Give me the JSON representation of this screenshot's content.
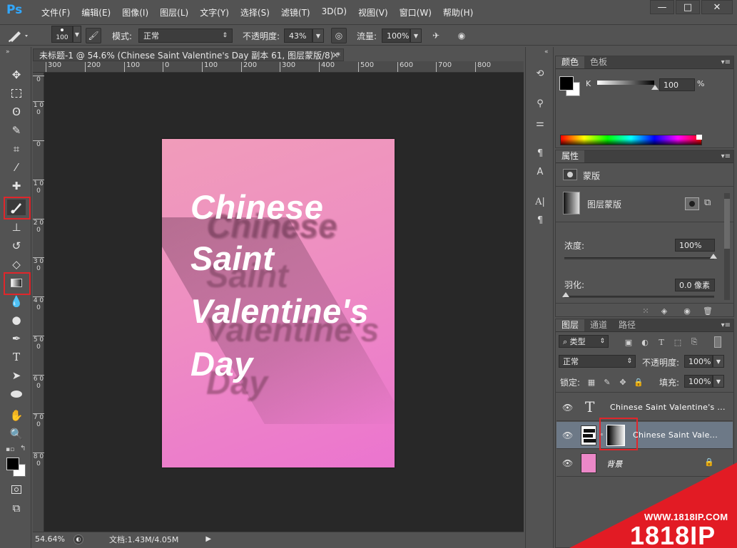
{
  "app": {
    "logo": "Ps"
  },
  "menu": [
    "文件(F)",
    "编辑(E)",
    "图像(I)",
    "图层(L)",
    "文字(Y)",
    "选择(S)",
    "滤镜(T)",
    "3D(D)",
    "视图(V)",
    "窗口(W)",
    "帮助(H)"
  ],
  "window_controls": {
    "minimize": "—",
    "restore": "□",
    "close": "✕"
  },
  "options": {
    "brush_size": "100",
    "mode_label": "模式:",
    "mode_value": "正常",
    "opacity_label": "不透明度:",
    "opacity_value": "43%",
    "flow_label": "流量:",
    "flow_value": "100%"
  },
  "document": {
    "tab_title": "未标题-1 @ 54.6% (Chinese  Saint  Valentine's  Day 副本 61, 图层蒙版/8) *",
    "tab_close": "×",
    "ruler_h": [
      "300",
      "200",
      "100",
      "0",
      "100",
      "200",
      "300",
      "400",
      "500",
      "600",
      "700",
      "800"
    ],
    "ruler_v": [
      "0",
      "1 0 0",
      "0",
      "1 0 0",
      "2 0 0",
      "3 0 0",
      "4 0 0",
      "5 0 0",
      "6 0 0",
      "7 0 0",
      "8 0 0"
    ],
    "canvas_lines": [
      "Chinese",
      "Saint",
      "Valentine's",
      "Day"
    ],
    "gradient_colors": [
      "#f09cba",
      "#eb74cf"
    ]
  },
  "status": {
    "zoom": "54.64%",
    "doc_info": "文档:1.43M/4.05M"
  },
  "color_panel": {
    "tabs": [
      "颜色",
      "色板"
    ],
    "channel": "K",
    "value": "100",
    "unit": "%"
  },
  "properties_panel": {
    "tab": "属性",
    "section_title": "蒙版",
    "mask_label": "图层蒙版",
    "density_label": "浓度:",
    "density_value": "100%",
    "feather_label": "羽化:",
    "feather_value": "0.0 像素"
  },
  "layers_panel": {
    "tabs": [
      "图层",
      "通道",
      "路径"
    ],
    "filter_label": "类型",
    "blend_mode": "正常",
    "opacity_label": "不透明度:",
    "opacity_value": "100%",
    "lock_label": "锁定:",
    "fill_label": "填充:",
    "fill_value": "100%",
    "layers": [
      {
        "name": "Chinese  Saint  Valentine's ...",
        "type": "text"
      },
      {
        "name": "Chinese  Saint  Vale...",
        "type": "masked"
      },
      {
        "name": "背景",
        "type": "background"
      }
    ]
  },
  "watermark": {
    "url": "WWW.1818IP.COM",
    "brand": "1818IP"
  },
  "colors": {
    "highlight_red": "#e0262b",
    "panel_bg": "#535353",
    "selected_layer": "#6d7987",
    "brand_red": "#e21b24"
  }
}
